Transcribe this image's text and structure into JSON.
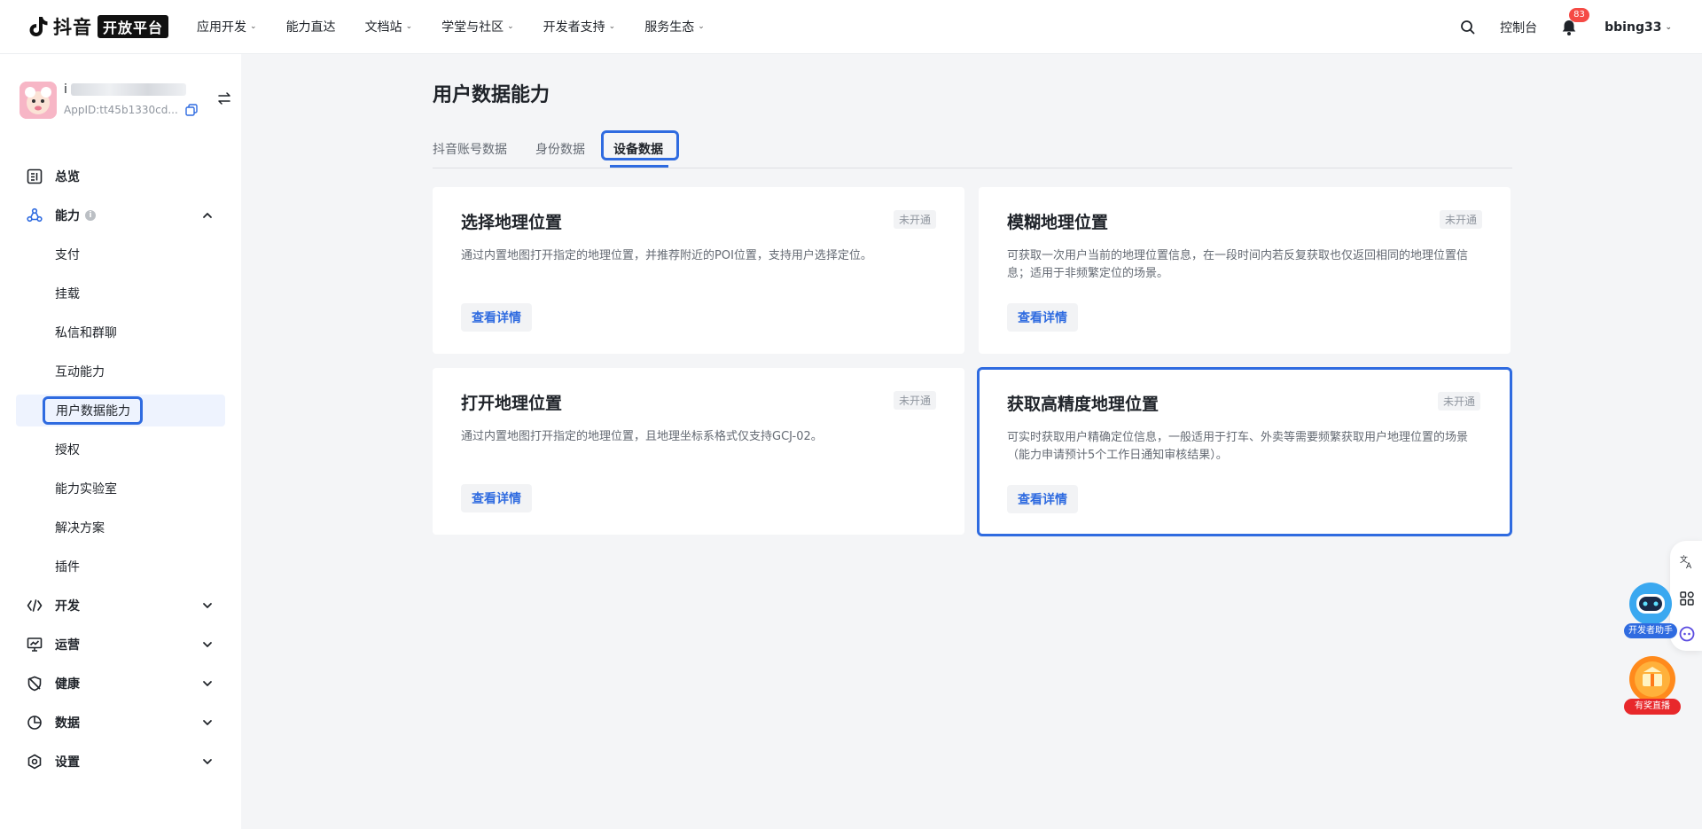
{
  "brand": {
    "name": "抖音",
    "badge": "开放平台"
  },
  "nav": {
    "items": [
      {
        "label": "应用开发",
        "has_caret": true
      },
      {
        "label": "能力直达",
        "has_caret": false
      },
      {
        "label": "文档站",
        "has_caret": true
      },
      {
        "label": "学堂与社区",
        "has_caret": true
      },
      {
        "label": "开发者支持",
        "has_caret": true
      },
      {
        "label": "服务生态",
        "has_caret": true
      }
    ],
    "console_label": "控制台",
    "notification_count": "83",
    "username": "bbing33"
  },
  "app": {
    "name_prefix": "i",
    "app_id": "AppID:tt45b1330cd..."
  },
  "sidebar": {
    "overview": "总览",
    "capability": "能力",
    "capability_info": "i",
    "sub_items": [
      "支付",
      "挂载",
      "私信和群聊",
      "互动能力",
      "用户数据能力",
      "授权",
      "能力实验室",
      "解决方案",
      "插件"
    ],
    "active_sub": "用户数据能力",
    "groups": [
      "开发",
      "运营",
      "健康",
      "数据",
      "设置"
    ]
  },
  "page": {
    "title": "用户数据能力",
    "tabs": [
      "抖音账号数据",
      "身份数据",
      "设备数据"
    ],
    "active_tab": "设备数据"
  },
  "cards": [
    {
      "title": "选择地理位置",
      "status": "未开通",
      "desc": "通过内置地图打开指定的地理位置，并推荐附近的POI位置，支持用户选择定位。",
      "button": "查看详情"
    },
    {
      "title": "模糊地理位置",
      "status": "未开通",
      "desc": "可获取一次用户当前的地理位置信息，在一段时间内若反复获取也仅返回相同的地理位置信息；适用于非频繁定位的场景。",
      "button": "查看详情"
    },
    {
      "title": "打开地理位置",
      "status": "未开通",
      "desc": "通过内置地图打开指定的地理位置，且地理坐标系格式仅支持GCJ-02。",
      "button": "查看详情"
    },
    {
      "title": "获取高精度地理位置",
      "status": "未开通",
      "desc": "可实时获取用户精确定位信息，一般适用于打车、外卖等需要频繁获取用户地理位置的场景（能力申请预计5个工作日通知审核结果）。",
      "button": "查看详情"
    }
  ],
  "floating": {
    "dev_helper": "开发者助手",
    "live": "有奖直播"
  },
  "colors": {
    "accent": "#2f6be0",
    "badge_red": "#f54a45",
    "page_bg": "#f4f5f7"
  }
}
